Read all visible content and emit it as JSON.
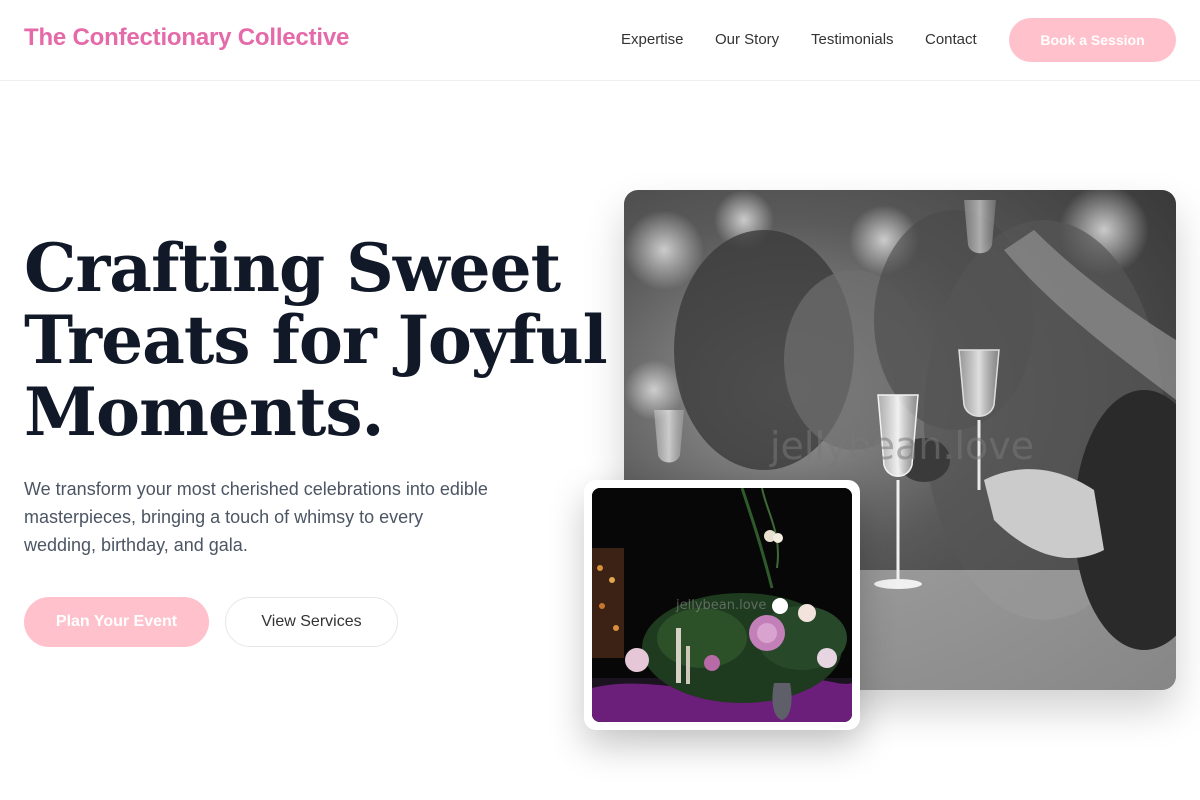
{
  "header": {
    "brand": "The Confectionary Collective",
    "nav": [
      "Expertise",
      "Our Story",
      "Testimonials",
      "Contact"
    ],
    "cta_label": "Book a Session"
  },
  "hero": {
    "title_lines": [
      "Crafting Sweet",
      "Treats for Joyful",
      "Moments."
    ],
    "description_lines": [
      "We transform your most cherished celebrations into edible",
      "masterpieces, bringing a touch of whimsy to every",
      "wedding, birthday, and gala."
    ],
    "primary_cta": "Plan Your Event",
    "secondary_cta": "View Services"
  },
  "images": {
    "main_watermark": "jellybean.love",
    "inset_watermark": "jellybean.love"
  },
  "colors": {
    "brand": "#e46aa9",
    "button_pink": "#ffc1cc",
    "heading": "#111827",
    "body_text": "#4b5563"
  }
}
